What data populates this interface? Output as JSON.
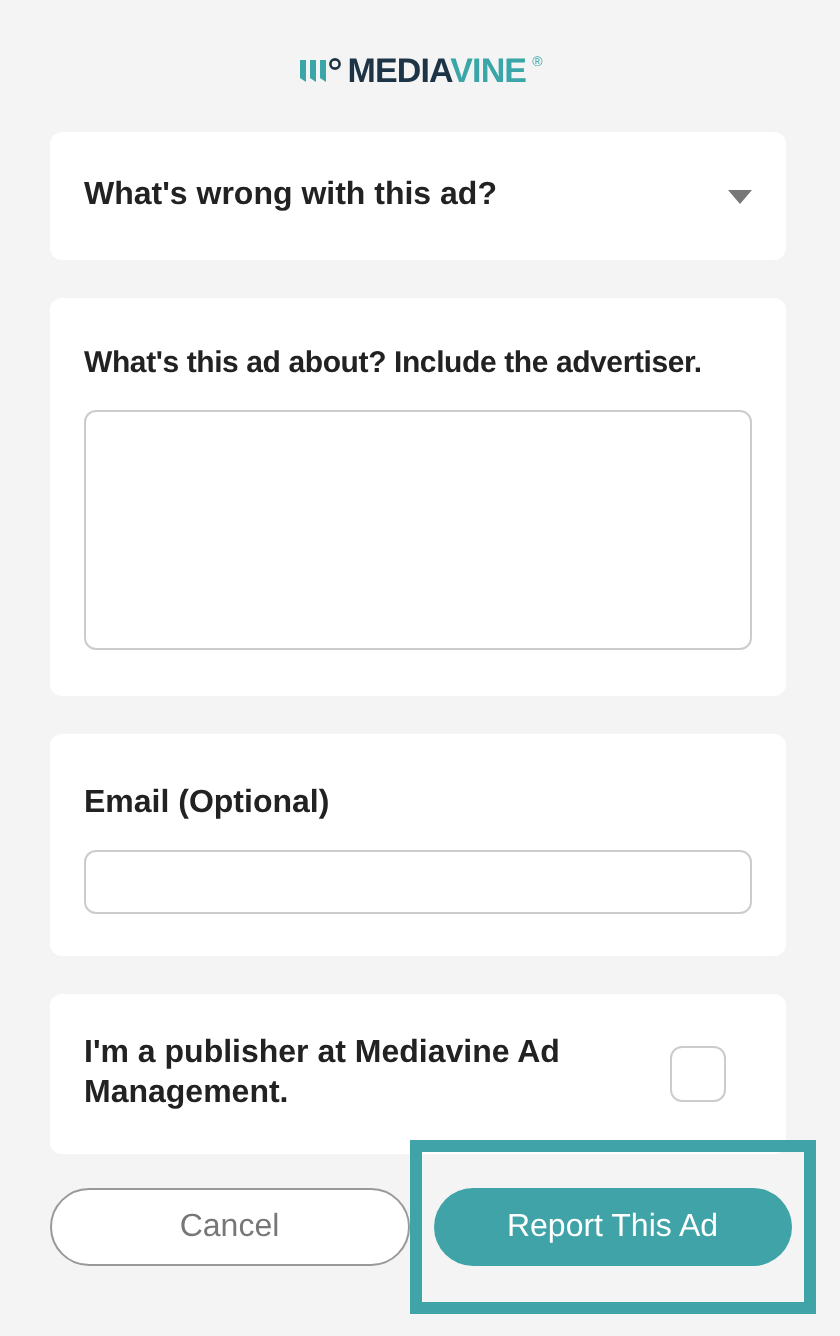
{
  "logo": {
    "part_1": "MEDIA",
    "part_2": "VINE",
    "mark": "®"
  },
  "issue_select": {
    "label": "What's wrong with this ad?",
    "expanded": false
  },
  "about": {
    "label": "What's this ad about? Include the advertiser."
  },
  "email": {
    "label": "Email (Optional)"
  },
  "publisher": {
    "label": "I'm a publisher at Mediavine Ad Management.",
    "checked": false
  },
  "buttons": [
    {
      "kind": "secondary",
      "label": "Cancel",
      "highlighted": false
    },
    {
      "kind": "primary",
      "label": "Report This Ad",
      "highlighted": true
    }
  ]
}
